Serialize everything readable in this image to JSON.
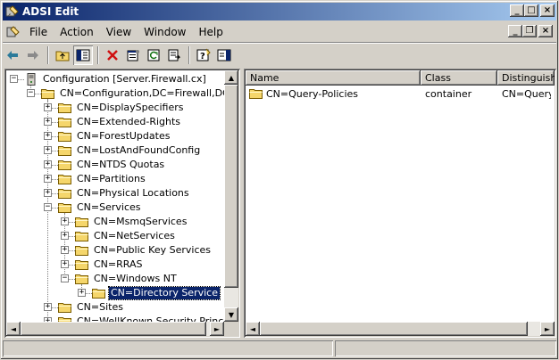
{
  "window": {
    "title": "ADSI Edit",
    "minimize_glyph": "_",
    "maximize_glyph": "□",
    "close_glyph": "×"
  },
  "menu": {
    "items": [
      {
        "label": "File",
        "name": "menu-file"
      },
      {
        "label": "Action",
        "name": "menu-action"
      },
      {
        "label": "View",
        "name": "menu-view"
      },
      {
        "label": "Window",
        "name": "menu-window"
      },
      {
        "label": "Help",
        "name": "menu-help"
      }
    ],
    "mdi_minimize": "_",
    "mdi_restore": "❐",
    "mdi_close": "×"
  },
  "toolbar": {
    "icons": [
      "back-arrow-icon",
      "forward-arrow-icon",
      "up-folder-icon",
      "show-hide-tree-icon",
      "delete-icon",
      "properties-icon",
      "refresh-icon",
      "export-list-icon",
      "help-icon",
      "console-tree-icon"
    ]
  },
  "tree": {
    "root": "Configuration [Server.Firewall.cx]",
    "level1": "CN=Configuration,DC=Firewall,DC=cx",
    "children": [
      "CN=DisplaySpecifiers",
      "CN=Extended-Rights",
      "CN=ForestUpdates",
      "CN=LostAndFoundConfig",
      "CN=NTDS Quotas",
      "CN=Partitions",
      "CN=Physical Locations",
      "CN=Services"
    ],
    "services_children": [
      "CN=MsmqServices",
      "CN=NetServices",
      "CN=Public Key Services",
      "CN=RRAS",
      "CN=Windows NT"
    ],
    "windows_nt_children": [
      "CN=Directory Service"
    ],
    "after": [
      "CN=Sites",
      "CN=WellKnown Security Principals"
    ],
    "selected": "CN=Directory Service",
    "plus": "+",
    "minus": "−"
  },
  "list": {
    "columns": [
      "Name",
      "Class",
      "Distinguished"
    ],
    "rows": [
      {
        "name": "CN=Query-Policies",
        "class": "container",
        "dn": "CN=Query-P"
      }
    ]
  },
  "scroll": {
    "up": "▲",
    "down": "▼",
    "left": "◄",
    "right": "►"
  },
  "colors": {
    "title_start": "#0a246a",
    "title_end": "#a6caf0",
    "selection": "#0a246a",
    "folder": "#f5d66b"
  }
}
